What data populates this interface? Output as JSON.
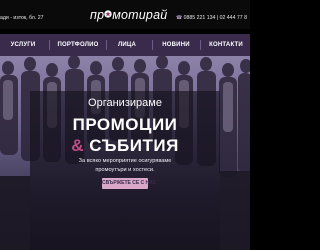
{
  "header": {
    "address": "ади - изток, бл. 27",
    "logo_text_before": "пр",
    "logo_text_after": "мотирай",
    "phones": "0885 221 134 | 02 444 77 8"
  },
  "nav": {
    "items": [
      {
        "label": "УСЛУГИ"
      },
      {
        "label": "ПОРТФОЛИО"
      },
      {
        "label": "ЛИЦА"
      },
      {
        "label": "НОВИНИ"
      },
      {
        "label": "КОНТАКТИ"
      }
    ]
  },
  "hero": {
    "line1": "Организираме",
    "line2": "ПРОМОЦИИ",
    "line3_amp": "&",
    "line3_rest": "СЪБИТИЯ",
    "lead_line1": "За всяко мероприятие осигуряваме",
    "lead_line2": "промоутъри и хостеси.",
    "cta_label": "СВЪРЖЕТЕ СЕ С НАС"
  },
  "colors": {
    "nav_bg": "#3a2b4d",
    "accent": "#c14e86",
    "cta_bg": "#d9a7c8"
  },
  "icons": {
    "logo_mark": "star-icon",
    "phone": "phone-icon"
  }
}
